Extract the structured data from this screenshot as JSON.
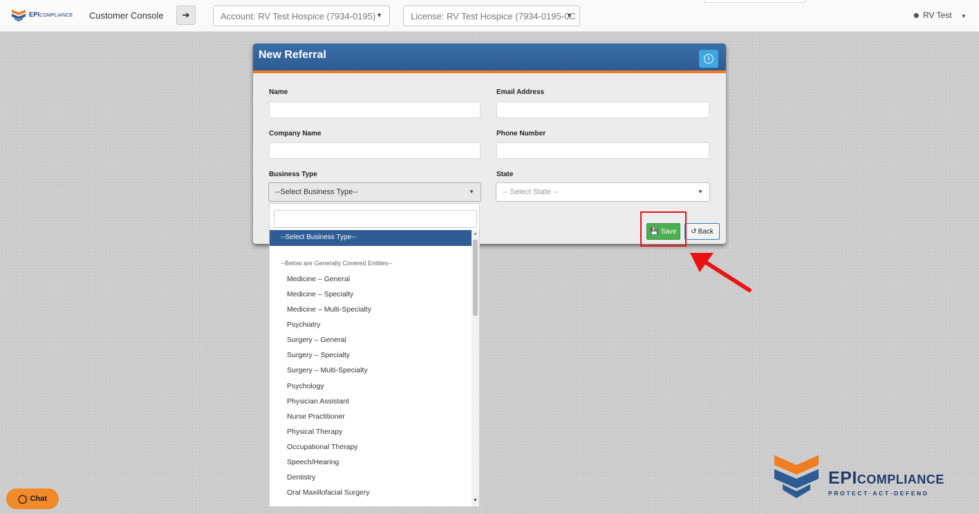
{
  "header": {
    "brand_main": "EPI",
    "brand_sub": "COMPLIANCE",
    "console_title": "Customer Console",
    "nav_arrow": "➔",
    "account_select": "Account: RV Test Hospice (7934-0195)",
    "license_select": "License: RV Test Hospice (7934-0195-0C",
    "user_name": "RV Test"
  },
  "modal": {
    "title": "New Referral",
    "fields": {
      "name_label": "Name",
      "email_label": "Email Address",
      "company_label": "Company Name",
      "phone_label": "Phone Number",
      "business_type_label": "Business Type",
      "state_label": "State"
    },
    "business_type_value": "--Select Business Type--",
    "state_placeholder": "-- Select State --",
    "save_label": "Save",
    "back_label": "Back"
  },
  "dropdown": {
    "selected": "--Select Business Type--",
    "group_label": "--Below are Generally Covered Entities--",
    "items": [
      "Medicine – General",
      "Medicine – Specialty",
      "Medicine – Multi-Specialty",
      "Psychiatry",
      "Surgery – General",
      "Surgery – Specialty",
      "Surgery – Multi-Specialty",
      "Psychology",
      "Physician Assistant",
      "Nurse Practitioner",
      "Physical Therapy",
      "Occupational Therapy",
      "Speech/Hearing",
      "Dentistry",
      "Oral Maxillofacial Surgery"
    ]
  },
  "chat": {
    "label": "Chat"
  },
  "footer_logo": {
    "brand_main": "EPI",
    "brand_sub": "COMPLIANCE",
    "tagline": "PROTECT·ACT·DEFEND"
  },
  "colors": {
    "header_blue": "#2d5b93",
    "accent_orange": "#ef7d23",
    "save_green": "#4caf50",
    "highlight_red": "#e81414"
  }
}
